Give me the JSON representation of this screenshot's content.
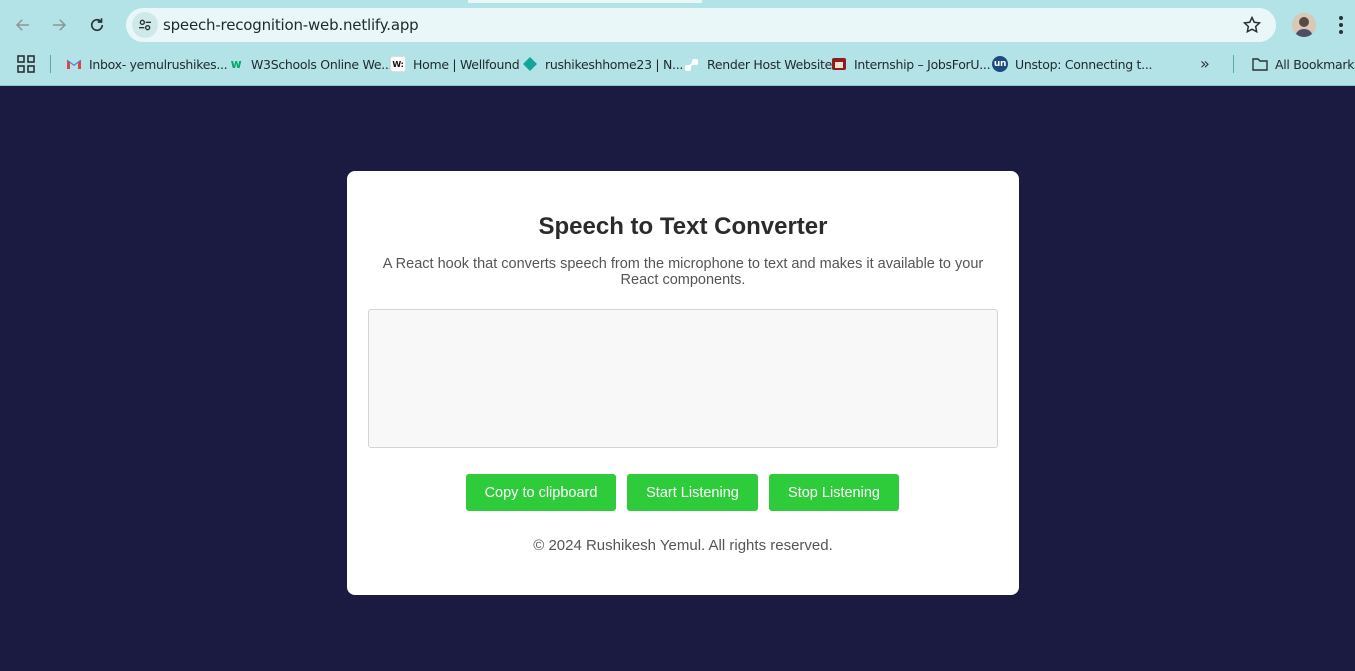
{
  "browser": {
    "url": "speech-recognition-web.netlify.app",
    "bookmarks": [
      {
        "label": "Inbox- yemulrushikes...",
        "icon": "gmail-icon"
      },
      {
        "label": "W3Schools Online We...",
        "icon": "w3schools-icon"
      },
      {
        "label": "Home | Wellfound",
        "icon": "wellfound-icon"
      },
      {
        "label": "rushikeshhome23 | N...",
        "icon": "netlify-icon"
      },
      {
        "label": "Render Host Website",
        "icon": "render-icon"
      },
      {
        "label": "Internship – JobsForU...",
        "icon": "jobsforu-icon"
      },
      {
        "label": "Unstop: Connecting t...",
        "icon": "unstop-icon"
      }
    ],
    "all_bookmarks_label": "All Bookmarks",
    "favicon_texts": {
      "wellfound": "W:",
      "unstop": "un"
    }
  },
  "page": {
    "title": "Speech to Text Converter",
    "subtitle": "A React hook that converts speech from the microphone to text and makes it available to your React components.",
    "transcript": "",
    "buttons": {
      "copy": "Copy to clipboard",
      "start": "Start Listening",
      "stop": "Stop Listening"
    },
    "footer": "© 2024 Rushikesh Yemul. All rights reserved."
  },
  "colors": {
    "page_background": "#1b1a40",
    "card_background": "#ffffff",
    "button_green": "#2ecc3a",
    "chrome_teal": "#b3e3e6"
  }
}
